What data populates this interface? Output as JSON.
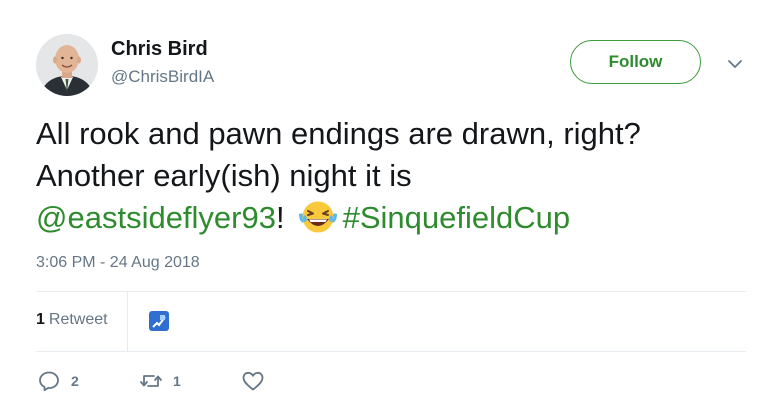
{
  "user": {
    "name": "Chris Bird",
    "handle": "@ChrisBirdIA"
  },
  "follow_button": {
    "label": "Follow"
  },
  "tweet": {
    "line1": "All rook and pawn endings are drawn, right?",
    "line2": "Another early(ish) night it is",
    "mention": "@eastsideflyer93",
    "after_mention": "!",
    "hashtag": "#SinquefieldCup",
    "emoji": "face-with-tears-of-joy"
  },
  "timestamp": "3:06 PM - 24 Aug 2018",
  "stats": {
    "retweets_count": "1",
    "retweets_label": "Retweet"
  },
  "actions": {
    "reply_count": "2",
    "retweet_count": "1",
    "like_count": ""
  },
  "colors": {
    "link": "#2e8b2e",
    "follow_border": "#3d9a3d",
    "muted": "#657786",
    "divider": "#e6ecf0"
  },
  "icons": {
    "caret": "chevron-down-icon",
    "reply": "reply-icon",
    "retweet": "retweet-icon",
    "like": "heart-icon"
  }
}
